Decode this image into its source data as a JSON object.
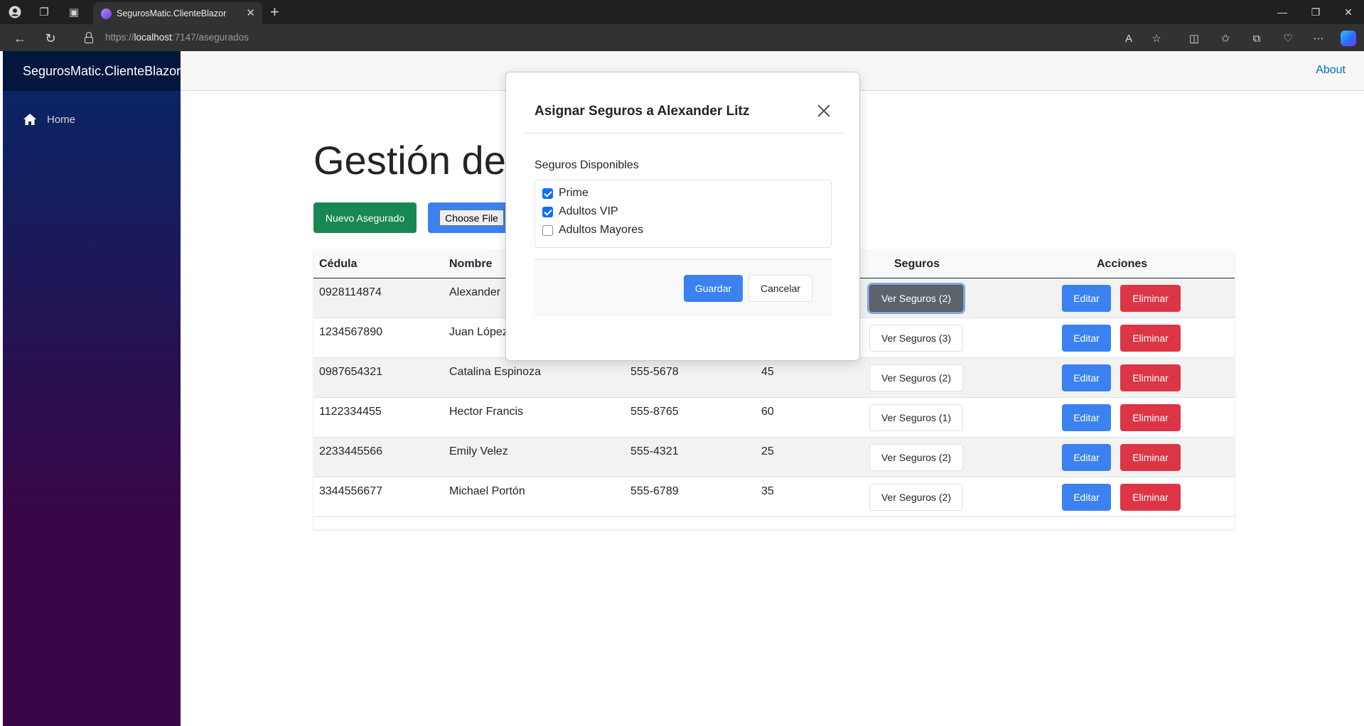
{
  "browser": {
    "tab_title": "SegurosMatic.ClienteBlazor",
    "url_scheme": "https://",
    "url_host": "localhost",
    "url_path": ":7147/asegurados"
  },
  "app": {
    "brand": "SegurosMatic.ClienteBlazor",
    "nav": {
      "home_label": "Home"
    },
    "top_link": "About"
  },
  "page": {
    "title": "Gestión de",
    "new_button": "Nuevo Asegurado",
    "file_button": "Choose File"
  },
  "table": {
    "headers": {
      "cedula": "Cédula",
      "nombre": "Nombre",
      "seguros": "Seguros",
      "acciones": "Acciones"
    },
    "rows": [
      {
        "cedula": "0928114874",
        "nombre": "Alexander",
        "telefono": "",
        "edad": "",
        "seguros": "Ver Seguros (2)"
      },
      {
        "cedula": "1234567890",
        "nombre": "Juan López",
        "telefono": "",
        "edad": "",
        "seguros": "Ver Seguros (3)"
      },
      {
        "cedula": "0987654321",
        "nombre": "Catalina Espinoza",
        "telefono": "555-5678",
        "edad": "45",
        "seguros": "Ver Seguros (2)"
      },
      {
        "cedula": "1122334455",
        "nombre": "Hector Francis",
        "telefono": "555-8765",
        "edad": "60",
        "seguros": "Ver Seguros (1)"
      },
      {
        "cedula": "2233445566",
        "nombre": "Emily Velez",
        "telefono": "555-4321",
        "edad": "25",
        "seguros": "Ver Seguros (2)"
      },
      {
        "cedula": "3344556677",
        "nombre": "Michael Portón",
        "telefono": "555-6789",
        "edad": "35",
        "seguros": "Ver Seguros (2)"
      }
    ],
    "edit_label": "Editar",
    "delete_label": "Eliminar"
  },
  "modal": {
    "title": "Asignar Seguros a Alexander Litz",
    "section_label": "Seguros Disponibles",
    "options": [
      {
        "label": "Prime",
        "checked": true
      },
      {
        "label": "Adultos VIP",
        "checked": true
      },
      {
        "label": "Adultos Mayores",
        "checked": false
      }
    ],
    "save_label": "Guardar",
    "cancel_label": "Cancelar"
  },
  "colors": {
    "primary": "#3b82f0",
    "success": "#198754",
    "danger": "#dc3545",
    "active_secondary": "#5c636a",
    "sidebar_top": "#052767",
    "sidebar_bottom": "#3a0647"
  },
  "icons": {
    "home": "home-icon",
    "close": "close-icon",
    "lock": "lock-icon"
  }
}
